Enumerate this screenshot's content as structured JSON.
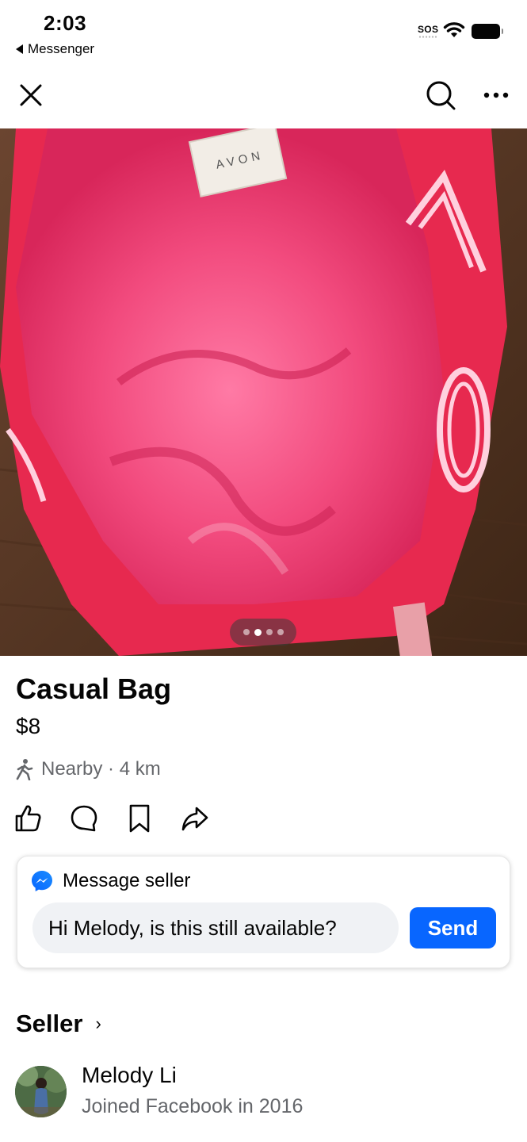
{
  "status_bar": {
    "time": "2:03",
    "back_app": "Messenger",
    "sos": "SOS"
  },
  "nav": {
    "close_icon": "close-icon",
    "search_icon": "search-icon",
    "more_icon": "more-icon"
  },
  "photo": {
    "brand_tag": "AVON",
    "photo_count": 4,
    "active_photo": 2
  },
  "listing": {
    "title": "Casual Bag",
    "price": "$8",
    "distance": "Nearby · 4 km"
  },
  "actions": [
    "like-icon",
    "comment-icon",
    "save-icon",
    "share-icon"
  ],
  "message_card": {
    "heading": "Message seller",
    "input_value": "Hi Melody, is this still available?",
    "send_label": "Send"
  },
  "seller": {
    "section_label": "Seller",
    "chevron": "›",
    "name": "Melody Li",
    "joined": "Joined Facebook in 2016"
  },
  "colors": {
    "accent": "#0866ff",
    "secondary_text": "#65676b",
    "input_bg": "#f0f2f5",
    "bag_pink": "#f0386a"
  }
}
